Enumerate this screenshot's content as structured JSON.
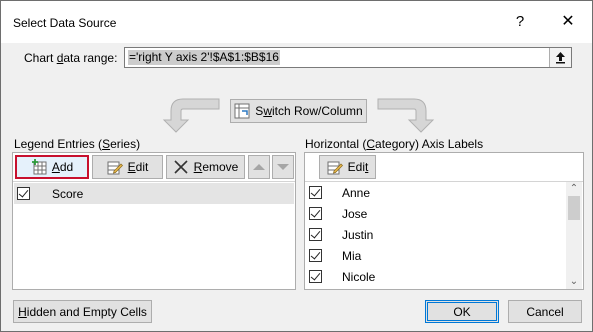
{
  "dialog": {
    "title": "Select Data Source",
    "help_glyph": "?",
    "close_glyph": "✕"
  },
  "range": {
    "label_pre": "Chart ",
    "label_accel": "d",
    "label_post": "ata range:",
    "value": "='right Y axis 2'!$A$1:$B$16"
  },
  "switch": {
    "label_pre": "S",
    "label_accel": "w",
    "label_post": "itch Row/Column"
  },
  "legend": {
    "label_pre": "Legend Entries (",
    "label_accel": "S",
    "label_post": "eries)",
    "add_accel": "A",
    "add_post": "dd",
    "edit_accel": "E",
    "edit_post": "dit",
    "remove_accel": "R",
    "remove_post": "emove",
    "series": [
      {
        "name": "Score",
        "checked": true
      }
    ]
  },
  "axis": {
    "label_pre": "Horizontal (",
    "label_accel": "C",
    "label_post": "ategory) Axis Labels",
    "edit_pre": "Edi",
    "edit_accel": "t",
    "categories": [
      {
        "name": "Anne",
        "checked": true
      },
      {
        "name": "Jose",
        "checked": true
      },
      {
        "name": "Justin",
        "checked": true
      },
      {
        "name": "Mia",
        "checked": true
      },
      {
        "name": "Nicole",
        "checked": true
      }
    ]
  },
  "footer": {
    "hidden_accel": "H",
    "hidden_post": "idden and Empty Cells",
    "ok_label": "OK",
    "cancel_label": "Cancel"
  },
  "colors": {
    "highlight_border": "#c8102e",
    "default_button_border": "#0078d7"
  }
}
